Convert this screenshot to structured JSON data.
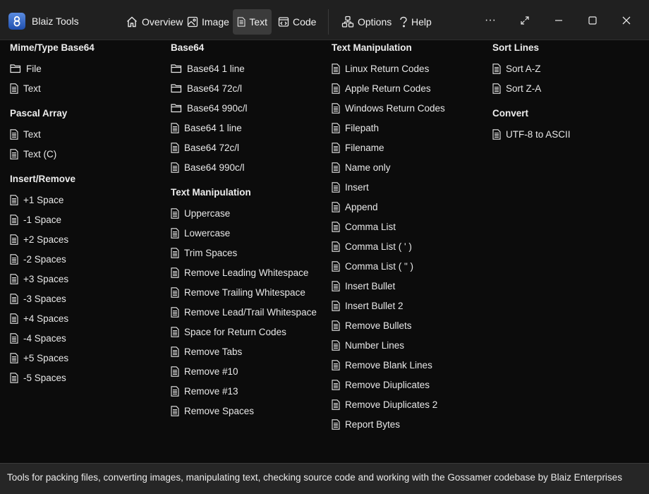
{
  "app": {
    "title": "Blaiz Tools",
    "accent": "#3b6fd0"
  },
  "nav": [
    {
      "label": "Overview",
      "icon": "home-icon"
    },
    {
      "label": "Image",
      "icon": "image-icon"
    },
    {
      "label": "Text",
      "icon": "document-icon",
      "active": true
    },
    {
      "label": "Code",
      "icon": "code-icon"
    },
    {
      "label": "Options",
      "icon": "options-icon"
    },
    {
      "label": "Help",
      "icon": "help-icon"
    }
  ],
  "window_controls": {
    "more": "···"
  },
  "columns": [
    {
      "sections": [
        {
          "title": "Mime/Type Base64",
          "items": [
            {
              "label": "File",
              "icon": "folder-icon"
            },
            {
              "label": "Text",
              "icon": "document-icon"
            }
          ]
        },
        {
          "title": "Pascal Array",
          "items": [
            {
              "label": "Text",
              "icon": "document-icon"
            },
            {
              "label": "Text (C)",
              "icon": "document-icon"
            }
          ]
        },
        {
          "title": "Insert/Remove",
          "items": [
            {
              "label": "+1 Space",
              "icon": "document-icon"
            },
            {
              "label": "-1 Space",
              "icon": "document-icon"
            },
            {
              "label": "+2 Spaces",
              "icon": "document-icon"
            },
            {
              "label": "-2 Spaces",
              "icon": "document-icon"
            },
            {
              "label": "+3 Spaces",
              "icon": "document-icon"
            },
            {
              "label": "-3 Spaces",
              "icon": "document-icon"
            },
            {
              "label": "+4 Spaces",
              "icon": "document-icon"
            },
            {
              "label": "-4 Spaces",
              "icon": "document-icon"
            },
            {
              "label": "+5 Spaces",
              "icon": "document-icon"
            },
            {
              "label": "-5 Spaces",
              "icon": "document-icon"
            }
          ]
        }
      ]
    },
    {
      "sections": [
        {
          "title": "Base64",
          "items": [
            {
              "label": "Base64 1 line",
              "icon": "folder-icon"
            },
            {
              "label": "Base64 72c/l",
              "icon": "folder-icon"
            },
            {
              "label": "Base64 990c/l",
              "icon": "folder-icon"
            },
            {
              "label": "Base64 1 line",
              "icon": "document-icon"
            },
            {
              "label": "Base64 72c/l",
              "icon": "document-icon"
            },
            {
              "label": "Base64 990c/l",
              "icon": "document-icon"
            }
          ]
        },
        {
          "title": "Text Manipulation",
          "items": [
            {
              "label": "Uppercase",
              "icon": "document-icon"
            },
            {
              "label": "Lowercase",
              "icon": "document-icon"
            },
            {
              "label": "Trim Spaces",
              "icon": "document-icon"
            },
            {
              "label": "Remove Leading Whitespace",
              "icon": "document-icon"
            },
            {
              "label": "Remove Trailing Whitespace",
              "icon": "document-icon"
            },
            {
              "label": "Remove Lead/Trail Whitespace",
              "icon": "document-icon"
            },
            {
              "label": "Space for Return Codes",
              "icon": "document-icon"
            },
            {
              "label": "Remove Tabs",
              "icon": "document-icon"
            },
            {
              "label": "Remove #10",
              "icon": "document-icon"
            },
            {
              "label": "Remove #13",
              "icon": "document-icon"
            },
            {
              "label": "Remove Spaces",
              "icon": "document-icon"
            }
          ]
        }
      ]
    },
    {
      "sections": [
        {
          "title": "Text Manipulation",
          "items": [
            {
              "label": "Linux Return Codes",
              "icon": "document-icon"
            },
            {
              "label": "Apple Return Codes",
              "icon": "document-icon"
            },
            {
              "label": "Windows Return Codes",
              "icon": "document-icon"
            },
            {
              "label": "Filepath",
              "icon": "document-icon"
            },
            {
              "label": "Filename",
              "icon": "document-icon"
            },
            {
              "label": "Name only",
              "icon": "document-icon"
            },
            {
              "label": "Insert",
              "icon": "document-icon"
            },
            {
              "label": "Append",
              "icon": "document-icon"
            },
            {
              "label": "Comma List",
              "icon": "document-icon"
            },
            {
              "label": "Comma List ( ' )",
              "icon": "document-icon"
            },
            {
              "label": "Comma List ( \" )",
              "icon": "document-icon"
            },
            {
              "label": "Insert Bullet",
              "icon": "document-icon"
            },
            {
              "label": "Insert Bullet 2",
              "icon": "document-icon"
            },
            {
              "label": "Remove Bullets",
              "icon": "document-icon"
            },
            {
              "label": "Number Lines",
              "icon": "document-icon"
            },
            {
              "label": "Remove Blank Lines",
              "icon": "document-icon"
            },
            {
              "label": "Remove Diuplicates",
              "icon": "document-icon"
            },
            {
              "label": "Remove Diuplicates 2",
              "icon": "document-icon"
            },
            {
              "label": "Report Bytes",
              "icon": "document-icon"
            }
          ]
        }
      ]
    },
    {
      "sections": [
        {
          "title": "Sort Lines",
          "items": [
            {
              "label": "Sort A-Z",
              "icon": "document-icon"
            },
            {
              "label": "Sort Z-A",
              "icon": "document-icon"
            }
          ]
        },
        {
          "title": "Convert",
          "items": [
            {
              "label": "UTF-8 to ASCII",
              "icon": "document-icon"
            }
          ]
        }
      ]
    }
  ],
  "status": {
    "text": "Tools for packing files, converting images, manipulating text, checking source code and working with the Gossamer codebase by Blaiz Enterprises"
  }
}
